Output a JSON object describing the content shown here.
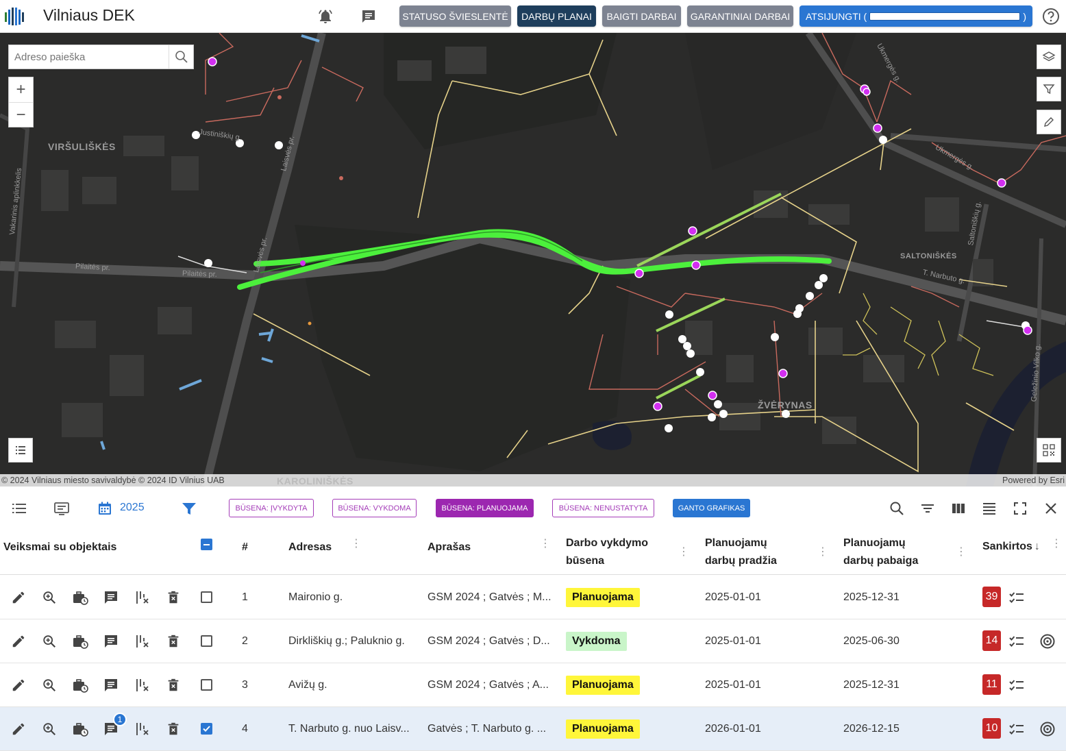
{
  "header": {
    "app_title": "Vilniaus DEK",
    "buttons": {
      "status_board": "STATUSO ŠVIESLENTĖ",
      "work_plans": "DARBŲ PLANAI",
      "finished_works": "BAIGTI DARBAI",
      "warranty_works": "GARANTINIAI DARBAI",
      "logout": "ATSIJUNGTI ("
    },
    "logout_suffix": ")"
  },
  "map": {
    "search_placeholder": "Adreso paieška",
    "zoom_in": "+",
    "zoom_out": "−",
    "labels": {
      "virsuliskes": "VIRŠULIŠKĖS",
      "saltoniskes": "SALTONIŠKĖS",
      "zverynas": "ŽVĖRYNAS",
      "karoliniskes": "KAROLINIŠKĖS"
    },
    "streets": {
      "pilaites": "Pilaitės pr.",
      "pilaites2": "Pilaitės pr.",
      "justiniskiu": "Justiniškių g.",
      "laisves": "Laisvės pr.",
      "laisves2": "Laisvės pr.",
      "ukmerges": "Ukmergės g.",
      "ukmerges2": "Ukmergės g.",
      "saltoniskiu": "Saltoniškių g.",
      "narbuto": "T. Narbuto g.",
      "vakarinis": "Vakarinis aplinkkelis",
      "gelezinio": "Geležinio Vilko g."
    },
    "attribution_left": "© 2024 Vilniaus miesto savivaldybė © 2024 ID Vilnius UAB",
    "attribution_right": "Powered by Esri"
  },
  "toolbar": {
    "year": "2025",
    "chips": {
      "ivykdyta": "BŪSENA: ĮVYKDYTA",
      "vykdoma": "BŪSENA: VYKDOMA",
      "planuojama": "BŪSENA: PLANUOJAMA",
      "nenustatyta": "BŪSENA: NENUSTATYTA",
      "gantt": "GANTO GRAFIKAS"
    }
  },
  "table": {
    "headers": {
      "actions": "Veiksmai su objektais",
      "num": "#",
      "address": "Adresas",
      "description": "Aprašas",
      "status_l1": "Darbo vykdymo",
      "status_l2": "būsena",
      "start_l1": "Planuojamų",
      "start_l2": "darbų pradžia",
      "end_l1": "Planuojamų",
      "end_l2": "darbų pabaiga",
      "intersections": "Sankirtos"
    },
    "rows": [
      {
        "num": "1",
        "address": "Maironio g.",
        "description": "GSM 2024 ; Gatvės ; M...",
        "status": "Planuojama",
        "start": "2025-01-01",
        "end": "2025-12-31",
        "intersections": "39"
      },
      {
        "num": "2",
        "address": "Dirkliškių g.; Paluknio g.",
        "description": "GSM 2024 ; Gatvės ; D...",
        "status": "Vykdoma",
        "start": "2025-01-01",
        "end": "2025-06-30",
        "intersections": "14"
      },
      {
        "num": "3",
        "address": "Avižų g.",
        "description": "GSM 2024 ; Gatvės ; A...",
        "status": "Planuojama",
        "start": "2025-01-01",
        "end": "2025-12-31",
        "intersections": "11"
      },
      {
        "num": "4",
        "address": "T. Narbuto g. nuo Laisv...",
        "description": "Gatvės ; T. Narbuto g. ...",
        "status": "Planuojama",
        "start": "2026-01-01",
        "end": "2026-12-15",
        "intersections": "10",
        "comment_badge": "1"
      }
    ]
  },
  "colors": {
    "accent": "#2a76d2",
    "header_dark": "#1e3e5c",
    "gray_button": "#7d8391",
    "planned_highlight": "#fff63a",
    "in_progress": "#c9f5c9",
    "intersections_red": "#c62828",
    "chip_purple": "#9c27b0",
    "map_background": "#2b2b2a",
    "planned_line": "#4cf03c"
  }
}
